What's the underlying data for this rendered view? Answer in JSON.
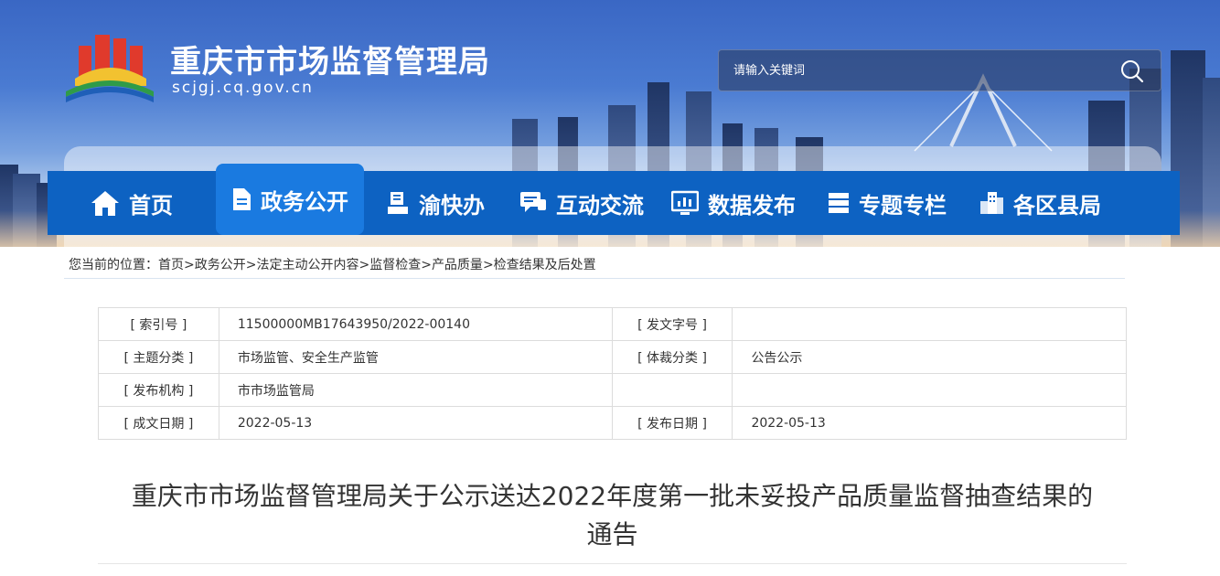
{
  "header": {
    "site_title": "重庆市市场监督管理局",
    "site_domain": "scjgj.cq.gov.cn",
    "search_placeholder": "请输入关键词"
  },
  "nav": {
    "items": [
      {
        "label": "首页",
        "icon": "home-icon"
      },
      {
        "label": "政务公开",
        "icon": "document-icon",
        "active": true
      },
      {
        "label": "渝快办",
        "icon": "stamp-icon"
      },
      {
        "label": "互动交流",
        "icon": "chat-icon"
      },
      {
        "label": "数据发布",
        "icon": "chart-monitor-icon"
      },
      {
        "label": "专题专栏",
        "icon": "stack-icon"
      },
      {
        "label": "各区县局",
        "icon": "buildings-icon"
      }
    ]
  },
  "breadcrumb": {
    "prefix": "您当前的位置：",
    "items": [
      "首页",
      "政务公开",
      "法定主动公开内容",
      "监督检查",
      "产品质量",
      "检查结果及后处置"
    ],
    "separator": ">"
  },
  "info": {
    "index_label": "[ 索引号 ]",
    "index_value": "11500000MB17643950/2022-00140",
    "doc_no_label": "[ 发文字号 ]",
    "doc_no_value": "",
    "topic_label": "[ 主题分类 ]",
    "topic_value": "市场监管、安全生产监管",
    "genre_label": "[ 体裁分类 ]",
    "genre_value": "公告公示",
    "org_label": "[ 发布机构 ]",
    "org_value": "市市场监管局",
    "created_label": "[ 成文日期 ]",
    "created_value": "2022-05-13",
    "published_label": "[ 发布日期 ]",
    "published_value": "2022-05-13"
  },
  "article": {
    "title_line1": "重庆市市场监督管理局关于公示送达2022年度第一批未妥投产品质量监督抽查结果的",
    "title_line2": "通告"
  },
  "colors": {
    "nav_bg": "#0d62c2",
    "nav_active": "#1a7ae0"
  }
}
